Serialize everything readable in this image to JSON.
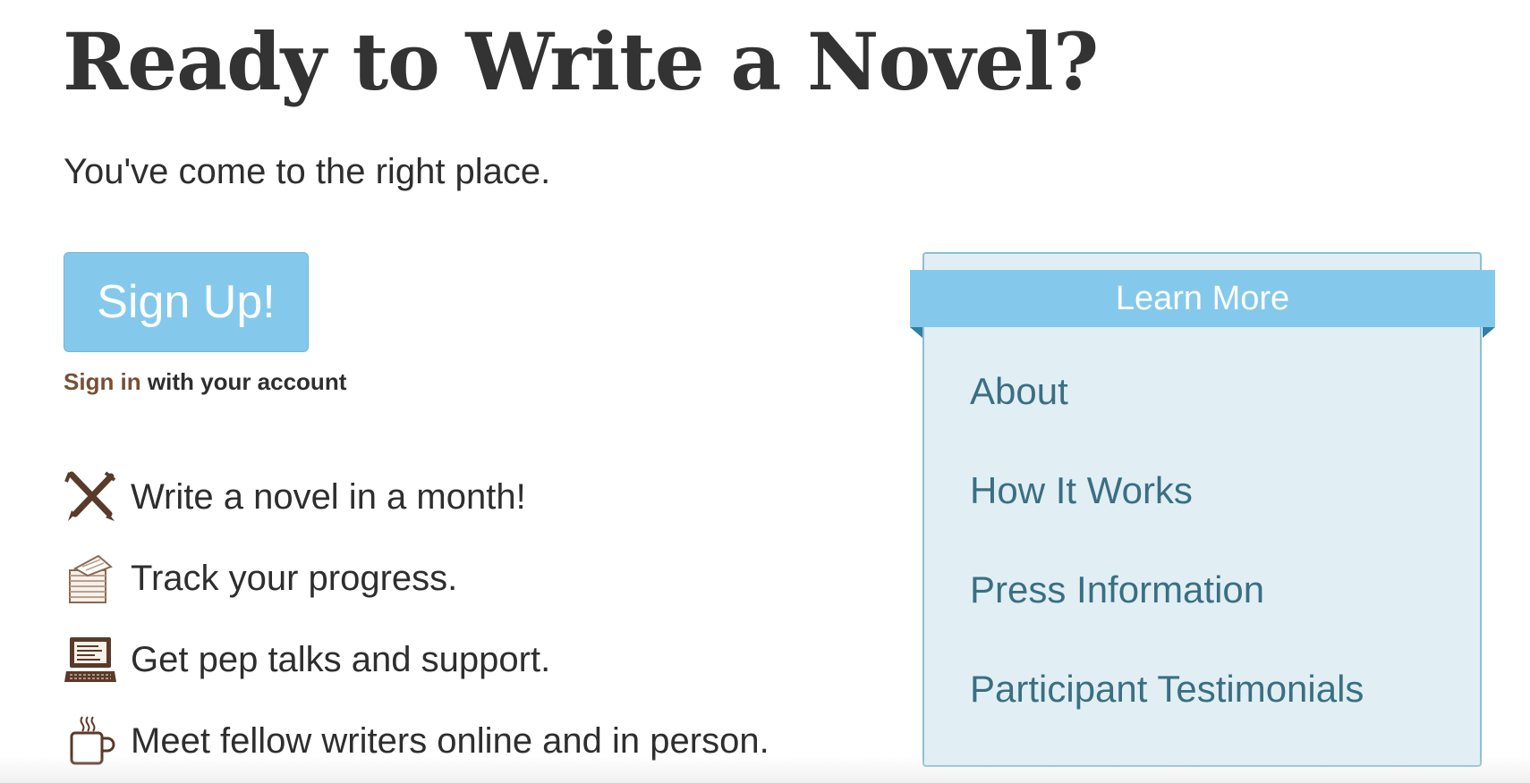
{
  "hero": {
    "title": "Ready to Write a Novel?",
    "subtitle": "You've come to the right place."
  },
  "signup": {
    "button_label": "Sign Up!",
    "signin_link": "Sign in",
    "signin_rest": " with your account"
  },
  "features": [
    {
      "icon": "crossed-pens-icon",
      "text": "Write a novel in a month!"
    },
    {
      "icon": "paper-stack-icon",
      "text": "Track your progress."
    },
    {
      "icon": "laptop-icon",
      "text": "Get pep talks and support."
    },
    {
      "icon": "coffee-mug-icon",
      "text": "Meet fellow writers online and in person."
    }
  ],
  "learn_more": {
    "heading": "Learn More",
    "links": [
      "About",
      "How It Works",
      "Press Information",
      "Participant Testimonials"
    ]
  },
  "colors": {
    "accent": "#84c9ec",
    "panel_bg": "#e1eff4",
    "link": "#3a6f83",
    "signin_link": "#7a4f33",
    "icon": "#5a3a28"
  }
}
